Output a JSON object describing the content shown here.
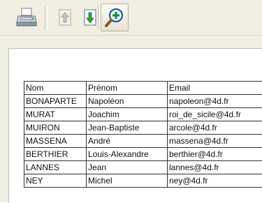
{
  "toolbar": {
    "buttons": [
      {
        "icon": "printer-icon"
      },
      {
        "icon": "page-up-icon"
      },
      {
        "icon": "page-down-icon"
      },
      {
        "icon": "zoom-in-icon"
      }
    ]
  },
  "table": {
    "headers": [
      "Nom",
      "Prénom",
      "Email"
    ],
    "rows": [
      [
        "BONAPARTE",
        "Napoléon",
        "napoleon@4d.fr"
      ],
      [
        "MURAT",
        "Joachim",
        "roi_de_sicile@4d.fr"
      ],
      [
        "MUIRON",
        "Jean-Baptiste",
        "arcole@4d.fr"
      ],
      [
        "MASSENA",
        "André",
        "massena@4d.fr"
      ],
      [
        "BERTHIER",
        "Louis-Alexandre",
        "berthier@4d.fr"
      ],
      [
        "LANNES",
        "Jean",
        "lannes@4d.fr"
      ],
      [
        "NEY",
        "Michel",
        "ney@4d.fr"
      ]
    ]
  }
}
